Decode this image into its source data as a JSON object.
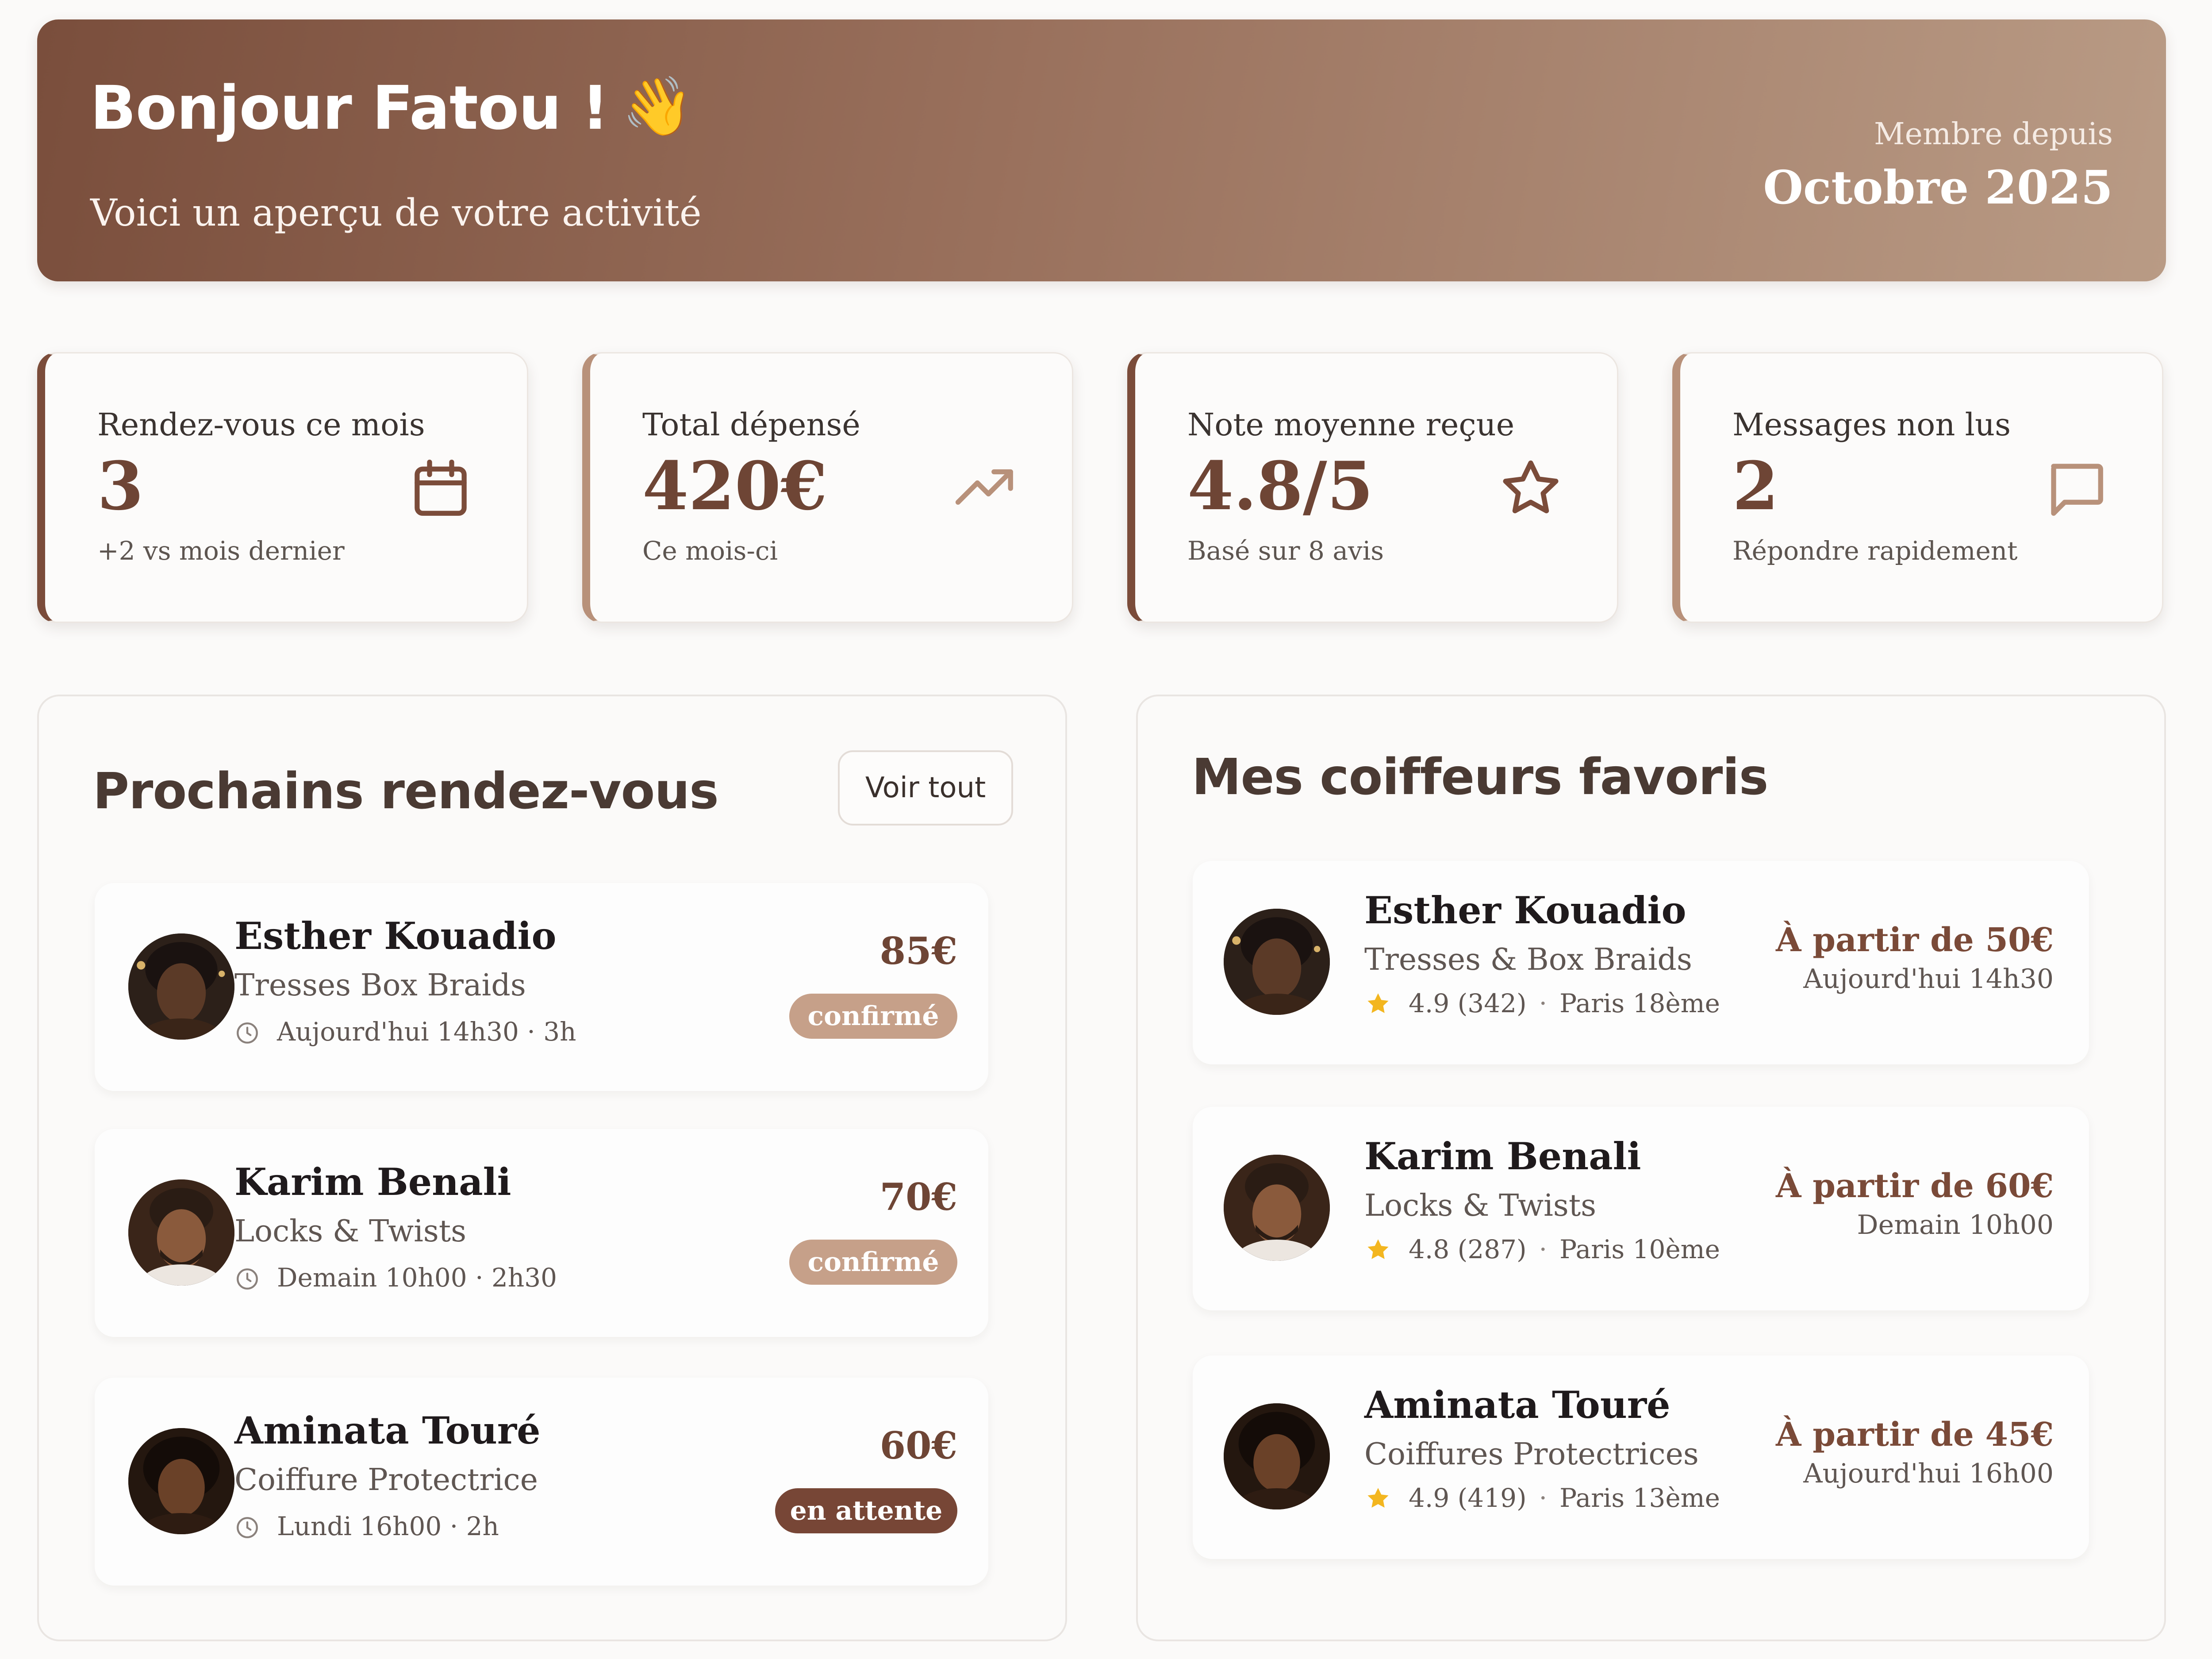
{
  "header": {
    "greeting": "Bonjour Fatou !",
    "wave_emoji": "👋",
    "subtitle": "Voici un aperçu de votre activité",
    "member_label": "Membre depuis",
    "member_since": "Octobre 2025"
  },
  "stats": [
    {
      "label": "Rendez-vous ce mois",
      "value": "3",
      "note": "+2 vs mois dernier",
      "icon": "calendar-icon"
    },
    {
      "label": "Total dépensé",
      "value": "420€",
      "note": "Ce mois-ci",
      "icon": "trending-up-icon"
    },
    {
      "label": "Note moyenne reçue",
      "value": "4.8/5",
      "note": "Basé sur 8 avis",
      "icon": "star-icon"
    },
    {
      "label": "Messages non lus",
      "value": "2",
      "note": "Répondre rapidement",
      "icon": "message-icon"
    }
  ],
  "appointments": {
    "title": "Prochains rendez-vous",
    "see_all": "Voir tout",
    "items": [
      {
        "name": "Esther Kouadio",
        "service": "Tresses Box Braids",
        "when": "Aujourd'hui 14h30 · 3h",
        "price": "85€",
        "status": "confirmé"
      },
      {
        "name": "Karim Benali",
        "service": "Locks & Twists",
        "when": "Demain 10h00 · 2h30",
        "price": "70€",
        "status": "confirmé"
      },
      {
        "name": "Aminata Touré",
        "service": "Coiffure Protectrice",
        "when": "Lundi 16h00 · 2h",
        "price": "60€",
        "status": "en attente"
      }
    ]
  },
  "favorites": {
    "title": "Mes coiffeurs favoris",
    "items": [
      {
        "name": "Esther Kouadio",
        "specialty": "Tresses & Box Braids",
        "rating": "4.9 (342)",
        "location": "Paris 18ème",
        "from": "À partir de 50€",
        "availability": "Aujourd'hui 14h30"
      },
      {
        "name": "Karim Benali",
        "specialty": "Locks & Twists",
        "rating": "4.8 (287)",
        "location": "Paris 10ème",
        "from": "À partir de 60€",
        "availability": "Demain 10h00"
      },
      {
        "name": "Aminata Touré",
        "specialty": "Coiffures Protectrices",
        "rating": "4.9 (419)",
        "location": "Paris 13ème",
        "from": "À partir de 45€",
        "availability": "Aujourd'hui 16h00"
      }
    ]
  },
  "colors": {
    "brand_dark": "#7b4c3a",
    "brand_light": "#b8917a",
    "status_confirmed": "#c6a089",
    "status_pending": "#774636",
    "star": "#f3b61f"
  }
}
